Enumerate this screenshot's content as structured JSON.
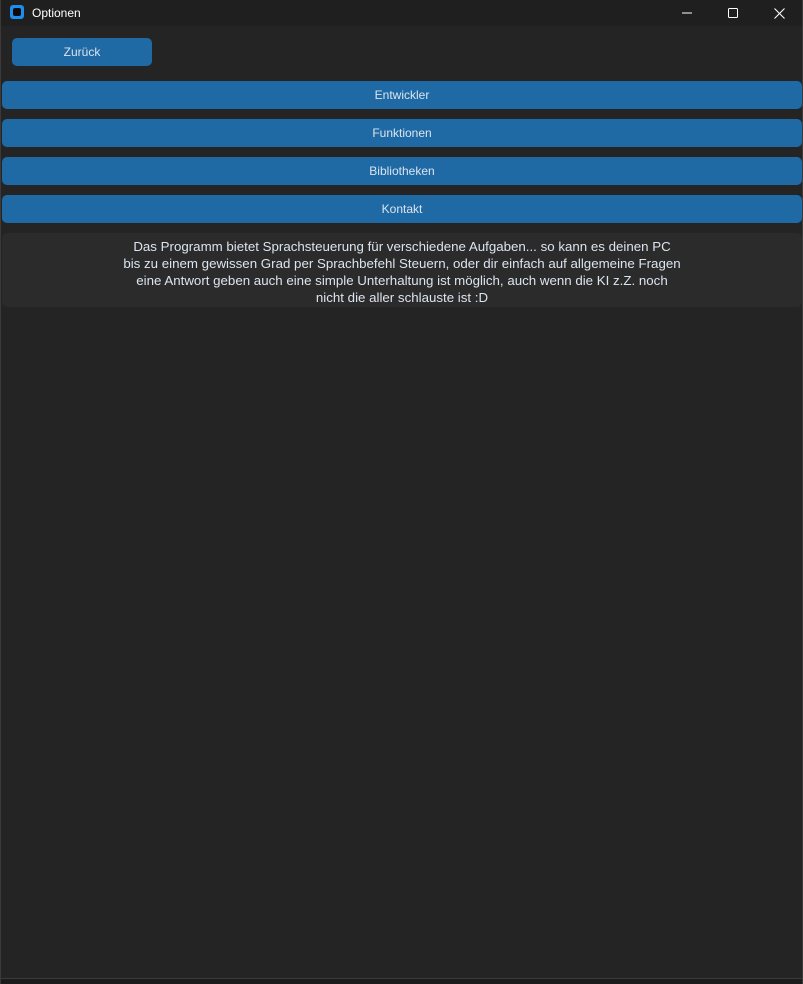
{
  "window": {
    "title": "Optionen"
  },
  "nav": {
    "back_label": "Zurück"
  },
  "menu": {
    "items": [
      {
        "label": "Entwickler"
      },
      {
        "label": "Funktionen"
      },
      {
        "label": "Bibliotheken"
      },
      {
        "label": "Kontakt"
      }
    ]
  },
  "info": {
    "text": "Das Programm bietet Sprachsteuerung für verschiedene Aufgaben...  so kann es deinen PC\nbis zu einem gewissen Grad per Sprachbefehl Steuern, oder dir einfach auf allgemeine Fragen\neine Antwort geben  auch eine simple Unterhaltung ist möglich,  auch wenn die KI z.Z. noch\nnicht die aller schlauste ist :D"
  },
  "icons": {
    "app": "app-icon",
    "minimize": "minimize-icon",
    "maximize": "maximize-icon",
    "close": "close-icon"
  },
  "colors": {
    "background": "#242424",
    "button": "#1f6aa5",
    "button_text": "#dce4ee",
    "panel": "#2b2b2b",
    "app_icon": "#1d8ef0"
  }
}
